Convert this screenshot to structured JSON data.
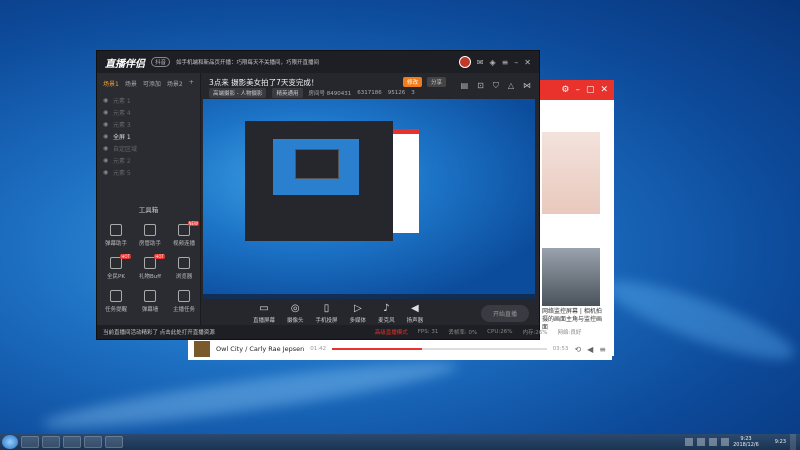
{
  "app": {
    "logo": "直播伴侣",
    "logo_badge": "抖音",
    "notice": "如手机端和新品页开播：巧限每天不关播间，巧限开直播间",
    "tabs": [
      "场景1",
      "场景",
      "可添加",
      "场景2"
    ],
    "scenes": [
      "元素 1",
      "元素 4",
      "元素 3",
      "全屏 1",
      "自定区域",
      "元素 2",
      "元素 5"
    ],
    "active_scene_index": 3,
    "toolbox_title": "工具箱",
    "tools": [
      {
        "label": "弹幕助手",
        "badge": ""
      },
      {
        "label": "房管助手",
        "badge": ""
      },
      {
        "label": "视频连播",
        "badge": "NEW"
      },
      {
        "label": "全民PK",
        "badge": "HOT"
      },
      {
        "label": "礼物Buff",
        "badge": "HOT"
      },
      {
        "label": "浏览器",
        "badge": ""
      },
      {
        "label": "任务提醒",
        "badge": ""
      },
      {
        "label": "弹幕墙",
        "badge": ""
      },
      {
        "label": "主播任务",
        "badge": ""
      }
    ]
  },
  "live": {
    "title": "3点来 摄影美女拍了7天变完成！",
    "modify_label": "修改",
    "share_label": "分享",
    "category": "高端摄影 - 人物摄影",
    "room_chip": "精英通用",
    "room_id": "房间号 8490431",
    "fans": "6317186",
    "likes": "95126",
    "online": "3"
  },
  "controls": [
    {
      "icon": "▭",
      "label": "直播屏幕"
    },
    {
      "icon": "◎",
      "label": "摄像头"
    },
    {
      "icon": "▯",
      "label": "手机投屏"
    },
    {
      "icon": "▷",
      "label": "多媒体"
    },
    {
      "icon": "♪",
      "label": "麦克风"
    },
    {
      "icon": "◀",
      "label": "扬声器"
    }
  ],
  "start_live_label": "开始直播",
  "status": {
    "warning": "当前直播间活动精彩了 点击此处打开直播资源",
    "mode": "高级直播模式",
    "fps": "FPS: 31",
    "bitrate": "丢帧率: 0%",
    "cpu": "CPU:26%",
    "mem": "内存:26%",
    "net": "网络:良好"
  },
  "player": {
    "track": "Owl City / Carly Rae Jepsen",
    "elapsed": "01:42",
    "total": "03:53",
    "progress": 0.42
  },
  "bgwin": {
    "caption": "网络监控屏幕 | 相机拍摄的画面主角与监控画面"
  },
  "taskbar": {
    "clock": "9:23",
    "date": "2018/12/6",
    "time_right": "9:23"
  }
}
